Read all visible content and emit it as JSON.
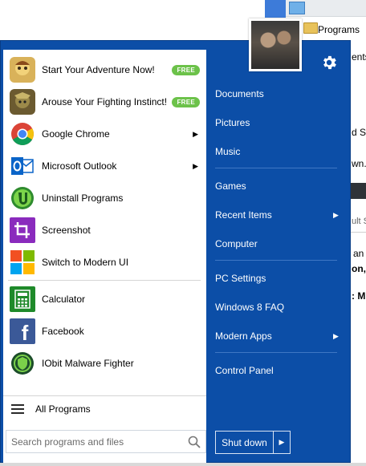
{
  "background_window": {
    "texts": [
      "Programs",
      "ents",
      "d Su",
      "wn.",
      "ult S",
      "an",
      "on,",
      ": M"
    ]
  },
  "programs": [
    {
      "label": "Start Your Adventure Now!",
      "badge": "FREE",
      "icon": "game-character-icon",
      "color": "#c7a34a"
    },
    {
      "label": "Arouse Your Fighting Instinct!",
      "badge": "FREE",
      "icon": "warrior-icon",
      "color": "#7a6a3a"
    },
    {
      "label": "Google Chrome",
      "arrow": true,
      "icon": "chrome-icon",
      "color": "#4285f4"
    },
    {
      "label": "Microsoft Outlook",
      "arrow": true,
      "icon": "outlook-icon",
      "color": "#0a64c8"
    },
    {
      "label": "Uninstall Programs",
      "icon": "uninstaller-icon",
      "color": "#2e8b2e"
    },
    {
      "label": "Screenshot",
      "icon": "crop-icon",
      "color": "#8a2bbd"
    },
    {
      "label": "Switch to Modern UI",
      "icon": "windows-tiles-icon",
      "color": "#ffffff"
    },
    {
      "label": "Calculator",
      "icon": "calculator-icon",
      "color": "#1f8a2a"
    },
    {
      "label": "Facebook",
      "icon": "facebook-icon",
      "color": "#3b5998"
    },
    {
      "label": "IObit Malware Fighter",
      "icon": "shield-icon",
      "color": "#1c4d2a"
    }
  ],
  "all_programs": "All Programs",
  "search": {
    "placeholder": "Search programs and files"
  },
  "right_items": [
    {
      "label": "Documents"
    },
    {
      "label": "Pictures"
    },
    {
      "label": "Music"
    },
    {
      "label": "Games"
    },
    {
      "label": "Recent Items",
      "arrow": true
    },
    {
      "label": "Computer"
    },
    {
      "label": "PC Settings"
    },
    {
      "label": "Windows 8 FAQ"
    },
    {
      "label": "Modern Apps",
      "arrow": true
    },
    {
      "label": "Control Panel"
    }
  ],
  "shutdown": {
    "label": "Shut down"
  },
  "colors": {
    "menu": "#0c4ea7",
    "badge": "#6cc24a"
  }
}
